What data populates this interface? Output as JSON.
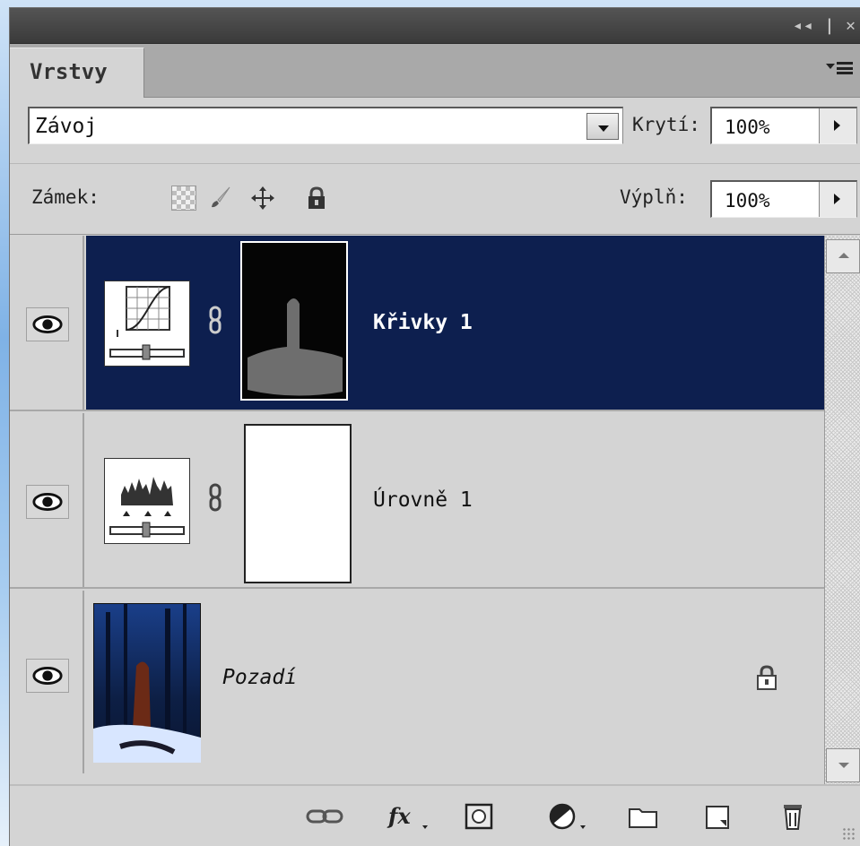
{
  "panel": {
    "window_controls": "◂◂ | ✕",
    "tab_label": "Vrstvy"
  },
  "blend": {
    "mode": "Závoj",
    "opacity_label": "Krytí:",
    "opacity_value": "100%"
  },
  "locks": {
    "label": "Zámek:",
    "fill_label": "Výplň:",
    "fill_value": "100%"
  },
  "layers": [
    {
      "name": "Křivky 1",
      "type": "curves-adjustment",
      "selected": true,
      "visible": true
    },
    {
      "name": "Úrovně 1",
      "type": "levels-adjustment",
      "selected": false,
      "visible": true
    },
    {
      "name": "Pozadí",
      "type": "background-image",
      "selected": false,
      "visible": true,
      "locked": true
    }
  ],
  "bottom_toolbar": [
    "link-icon",
    "fx-icon",
    "add-mask-icon",
    "adjustment-layer-icon",
    "new-group-icon",
    "new-layer-icon",
    "trash-icon"
  ],
  "colors": {
    "selection": "#0d1f4f",
    "panel_bg": "#d4d4d4"
  }
}
